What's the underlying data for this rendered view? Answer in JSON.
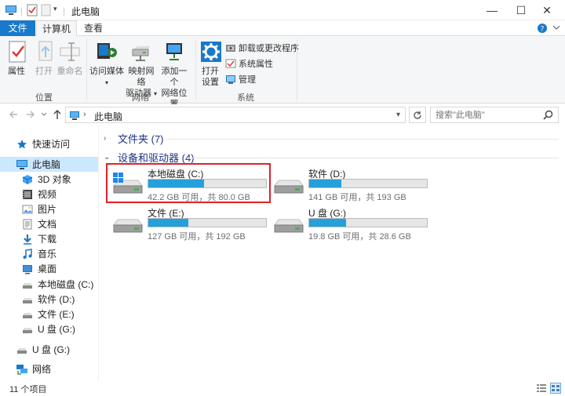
{
  "window": {
    "title": "此电脑",
    "minimize": "—",
    "maximize": "☐",
    "close": "✕"
  },
  "ribbon_tabs": {
    "file": "文件",
    "computer": "计算机",
    "view": "查看"
  },
  "ribbon": {
    "location": {
      "label": "位置",
      "properties": "属性",
      "open": "打开",
      "rename": "重命名"
    },
    "network": {
      "label": "网络",
      "access_media": "访问媒体",
      "map_drive_line1": "映射网络",
      "map_drive_line2": "驱动器",
      "add_location_line1": "添加一个",
      "add_location_line2": "网络位置"
    },
    "system": {
      "label": "系统",
      "open_settings_line1": "打开",
      "open_settings_line2": "设置",
      "uninstall": "卸载或更改程序",
      "system_properties": "系统属性",
      "manage": "管理"
    }
  },
  "address_bar": {
    "crumb": "此电脑",
    "search_placeholder": "搜索\"此电脑\""
  },
  "sidebar": {
    "items": [
      {
        "label": "快速访问",
        "icon": "star-icon"
      },
      {
        "label": "此电脑",
        "icon": "computer-icon"
      },
      {
        "label": "3D 对象",
        "icon": "cube-icon"
      },
      {
        "label": "视频",
        "icon": "video-icon"
      },
      {
        "label": "图片",
        "icon": "picture-icon"
      },
      {
        "label": "文档",
        "icon": "document-icon"
      },
      {
        "label": "下载",
        "icon": "download-icon"
      },
      {
        "label": "音乐",
        "icon": "music-icon"
      },
      {
        "label": "桌面",
        "icon": "desktop-icon"
      },
      {
        "label": "本地磁盘 (C:)",
        "icon": "drive-icon"
      },
      {
        "label": "软件 (D:)",
        "icon": "drive-icon"
      },
      {
        "label": "文件 (E:)",
        "icon": "drive-icon"
      },
      {
        "label": "U 盘 (G:)",
        "icon": "drive-icon"
      },
      {
        "label": "U 盘 (G:)",
        "icon": "drive-icon"
      },
      {
        "label": "网络",
        "icon": "network-icon"
      }
    ]
  },
  "content": {
    "folders_group": "文件夹 (7)",
    "devices_group": "设备和驱动器 (4)",
    "drives": [
      {
        "name": "本地磁盘 (C:)",
        "size": "42.2 GB 可用，共 80.0 GB",
        "used_fraction": 0.47,
        "system": true
      },
      {
        "name": "软件 (D:)",
        "size": "141 GB 可用，共 193 GB",
        "used_fraction": 0.27,
        "system": false
      },
      {
        "name": "文件 (E:)",
        "size": "127 GB 可用，共 192 GB",
        "used_fraction": 0.34,
        "system": false
      },
      {
        "name": "U 盘 (G:)",
        "size": "19.8 GB 可用，共 28.6 GB",
        "used_fraction": 0.31,
        "system": false
      }
    ]
  },
  "status_bar": {
    "item_count": "11 个项目"
  },
  "colors": {
    "accent": "#1979ca",
    "selection": "#cce8ff",
    "progress": "#26a0da",
    "highlight": "#e0202a",
    "group_heading": "#1e3287"
  }
}
